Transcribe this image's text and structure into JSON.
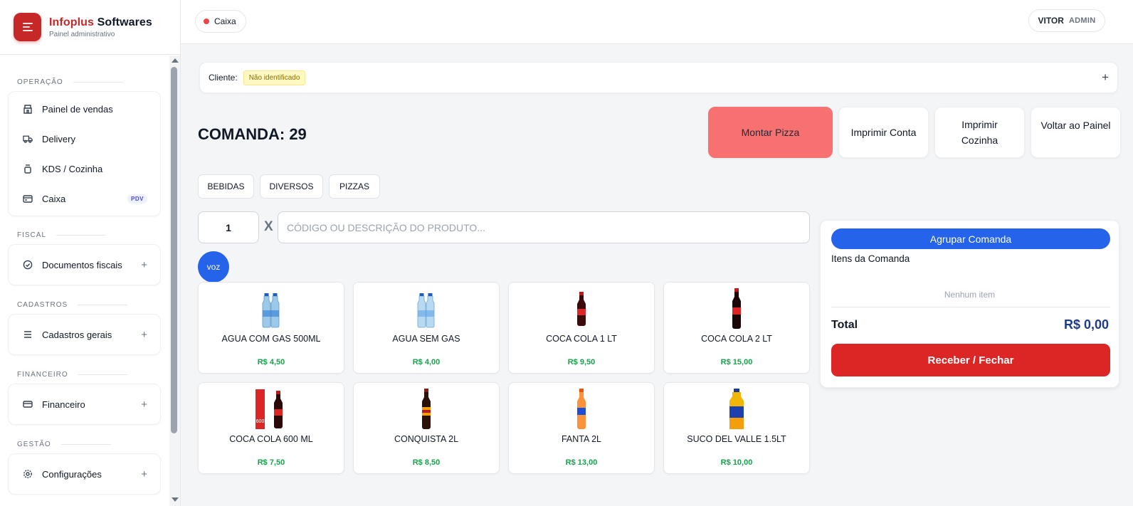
{
  "brand": {
    "title_red": "Infoplus",
    "title_dark": "Softwares",
    "subtitle": "Painel administrativo"
  },
  "sidebar": {
    "sections": [
      {
        "label": "OPERAÇÃO",
        "items": [
          {
            "label": "Painel de vendas",
            "icon": "store-icon"
          },
          {
            "label": "Delivery",
            "icon": "truck-icon"
          },
          {
            "label": "KDS / Cozinha",
            "icon": "pot-icon"
          },
          {
            "label": "Caixa",
            "icon": "register-icon",
            "badge": "PDV"
          }
        ]
      },
      {
        "label": "FISCAL",
        "items": [
          {
            "label": "Documentos fiscais",
            "icon": "check-circle-icon"
          }
        ]
      },
      {
        "label": "CADASTROS",
        "items": [
          {
            "label": "Cadastros gerais",
            "icon": "list-icon"
          }
        ]
      },
      {
        "label": "FINANCEIRO",
        "items": [
          {
            "label": "Financeiro",
            "icon": "card-icon"
          }
        ]
      },
      {
        "label": "GESTÃO",
        "items": [
          {
            "label": "Configurações",
            "icon": "gear-icon"
          }
        ]
      }
    ]
  },
  "topbar": {
    "caixa_label": "Caixa",
    "user_name": "VITOR",
    "user_role": "ADMIN"
  },
  "cliente": {
    "label": "Cliente:",
    "status": "Não identificado",
    "add": "+"
  },
  "comanda": {
    "title": "COMANDA: 29"
  },
  "actions": {
    "montar_pizza": "Montar Pizza",
    "imprimir_conta": "Imprimir Conta",
    "imprimir_cozinha": "Imprimir Cozinha",
    "voltar": "Voltar ao Painel"
  },
  "categories": [
    "BEBIDAS",
    "DIVERSOS",
    "PIZZAS"
  ],
  "entry": {
    "quantity": "1",
    "x": "X",
    "search_placeholder": "CÓDIGO OU DESCRIÇÃO DO PRODUTO...",
    "voz": "voz"
  },
  "products": [
    {
      "name": "AGUA COM GAS 500ML",
      "price": "R$ 4,50"
    },
    {
      "name": "AGUA SEM GAS",
      "price": "R$ 4,00"
    },
    {
      "name": "COCA COLA 1 LT",
      "price": "R$ 9,50"
    },
    {
      "name": "COCA COLA 2 LT",
      "price": "R$ 15,00"
    },
    {
      "name": "COCA COLA 600 ML",
      "price": "R$ 7,50"
    },
    {
      "name": "CONQUISTA 2L",
      "price": "R$ 8,50"
    },
    {
      "name": "FANTA 2L",
      "price": "R$ 13,00"
    },
    {
      "name": "SUCO DEL VALLE 1.5LT",
      "price": "R$ 10,00"
    }
  ],
  "panel": {
    "agrupar": "Agrupar Comanda",
    "itens_title": "Itens da Comanda",
    "empty": "Nenhum item",
    "total_label": "Total",
    "total_value": "R$ 0,00",
    "receber": "Receber / Fechar"
  },
  "colors": {
    "brand_red": "#c62828",
    "accent_blue": "#2563eb",
    "pizza_btn": "#f87171",
    "price_green": "#16a34a",
    "receber_red": "#dc2626"
  }
}
